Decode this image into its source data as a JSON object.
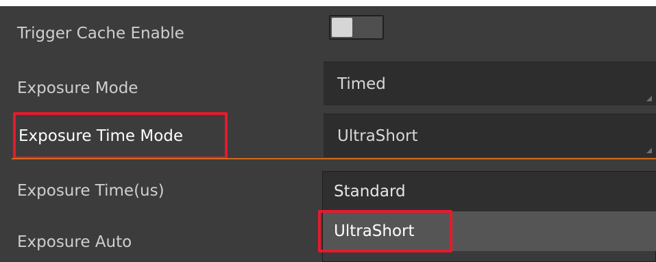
{
  "properties": {
    "trigger_cache": {
      "label": "Trigger Cache Enable",
      "toggle_state": "off"
    },
    "exposure_mode": {
      "label": "Exposure Mode",
      "value": "Timed"
    },
    "exposure_time_mode": {
      "label": "Exposure Time Mode",
      "value": "UltraShort"
    },
    "exposure_time": {
      "label": "Exposure Time(us)"
    },
    "exposure_auto": {
      "label": "Exposure Auto"
    }
  },
  "dropdown": {
    "options": [
      {
        "label": "Standard",
        "selected": false
      },
      {
        "label": "UltraShort",
        "selected": true
      }
    ]
  },
  "colors": {
    "panel_background": "#3c3c3c",
    "value_background": "#2d2d2d",
    "highlight_box": "#e8192c",
    "separator_line": "#d2691e",
    "label_text": "#cfcfcf"
  }
}
